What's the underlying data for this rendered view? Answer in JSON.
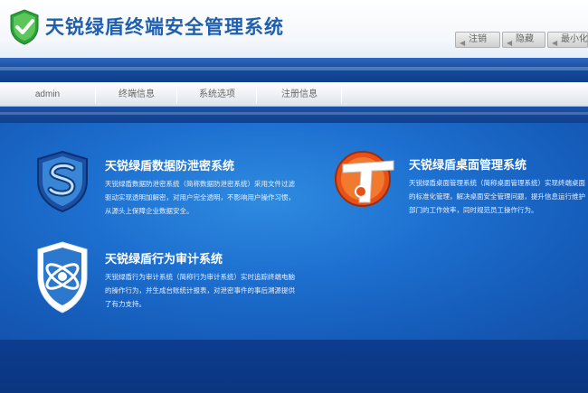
{
  "app": {
    "title": "天锐绿盾终端安全管理系统"
  },
  "window_controls": {
    "logout": "注销",
    "hide": "隐藏",
    "minimize": "最小化"
  },
  "nav": {
    "items": [
      {
        "label": "admin"
      },
      {
        "label": "终端信息"
      },
      {
        "label": "系统选项"
      },
      {
        "label": "注册信息"
      }
    ]
  },
  "modules": {
    "dlp": {
      "name": "天锐绿盾数据防泄密系统",
      "desc": "天锐绿盾数据防泄密系统（简称数据防泄密系统）采用文件过滤驱动实现透明加解密，对用户完全透明，不影响用户操作习惯，从源头上保障企业数据安全。"
    },
    "desktop": {
      "name": "天锐绿盾桌面管理系统",
      "desc": "天锐绿盾桌面管理系统（简称桌面管理系统）实现终端桌面的标准化管理，解决桌面安全管理问题，提升信息运行维护部门的工作效率，同时规范员工操作行为。"
    },
    "audit": {
      "name": "天锐绿盾行为审计系统",
      "desc": "天锐绿盾行为审计系统（简称行为审计系统）实时追踪终端电脑的操作行为，并生成台账统计报表，对泄密事件的事后溯源提供了有力支持。"
    }
  },
  "colors": {
    "brand_blue": "#1f5fb0",
    "logo_green": "#2aa13a",
    "panel_blue": "#1d6fcf",
    "desktop_icon_orange": "#e8501a"
  },
  "icons": {
    "logo": "green-shield-check-icon",
    "dlp": "blue-shield-s-icon",
    "desktop": "orange-t-circle-icon",
    "audit": "white-shield-orbit-icon"
  }
}
